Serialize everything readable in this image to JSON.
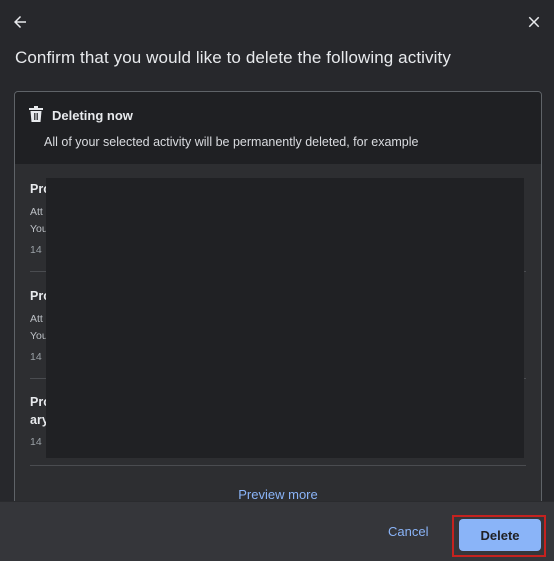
{
  "dialog": {
    "title": "Confirm that you would like to delete the following activity"
  },
  "notice": {
    "heading": "Deleting now",
    "description": "All of your selected activity will be permanently deleted, for example"
  },
  "items": [
    {
      "title": "Pro",
      "line1": "Att",
      "line2": "You",
      "date": "14"
    },
    {
      "title": "Pro",
      "line1": "Att",
      "line2": "You",
      "date": "14"
    },
    {
      "title": "Pro",
      "title2": "ary",
      "date": "14"
    }
  ],
  "preview_more": "Preview more",
  "footer": {
    "cancel_label": "Cancel",
    "delete_label": "Delete"
  },
  "colors": {
    "accent": "#8ab4f8",
    "highlight_border": "#c5221f",
    "background": "#27282c"
  },
  "icons": {
    "back": "arrow-back-icon",
    "close": "close-icon",
    "trash": "trash-icon"
  }
}
